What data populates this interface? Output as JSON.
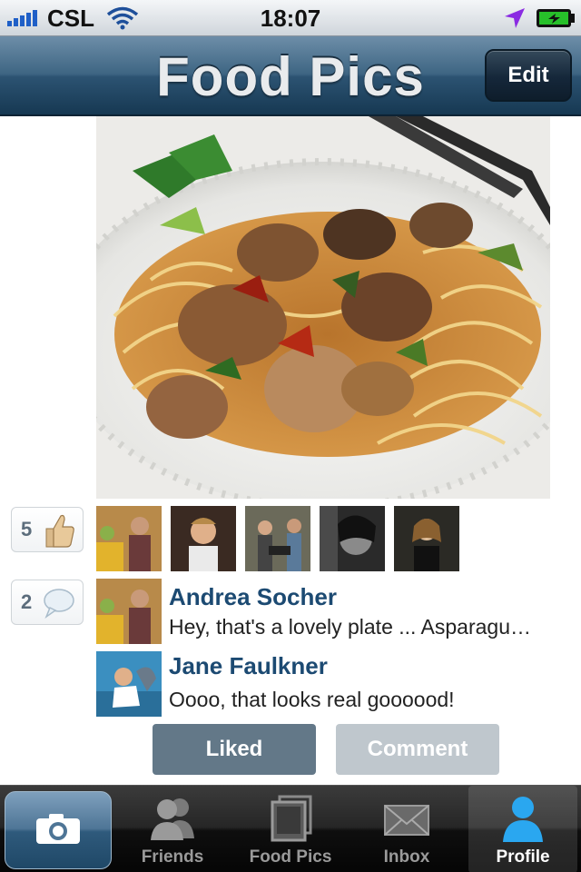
{
  "status_bar": {
    "carrier": "CSL",
    "time": "18:07"
  },
  "nav": {
    "title": "Food Pics",
    "edit_label": "Edit"
  },
  "post": {
    "photo_icon": "food-photo",
    "likes_count": "5",
    "comments_count": "2",
    "likers_count": 5,
    "comments": [
      {
        "name": "Andrea Socher",
        "text": "Hey, that's a lovely plate ... Asparagu…"
      },
      {
        "name": "Jane Faulkner",
        "text": "Oooo, that looks real goooood!"
      }
    ],
    "liked_label": "Liked",
    "comment_label": "Comment"
  },
  "tab_bar": {
    "camera_icon": "camera-icon",
    "tabs": [
      {
        "label": "Friends",
        "icon": "friends-icon"
      },
      {
        "label": "Food Pics",
        "icon": "photos-icon"
      },
      {
        "label": "Inbox",
        "icon": "envelope-icon"
      },
      {
        "label": "Profile",
        "icon": "person-icon",
        "active": true
      }
    ]
  },
  "colors": {
    "nav_blue": "#2c5372",
    "name_blue": "#1c4a72",
    "liked_button": "#637888",
    "comment_button": "#bfc7cd"
  }
}
